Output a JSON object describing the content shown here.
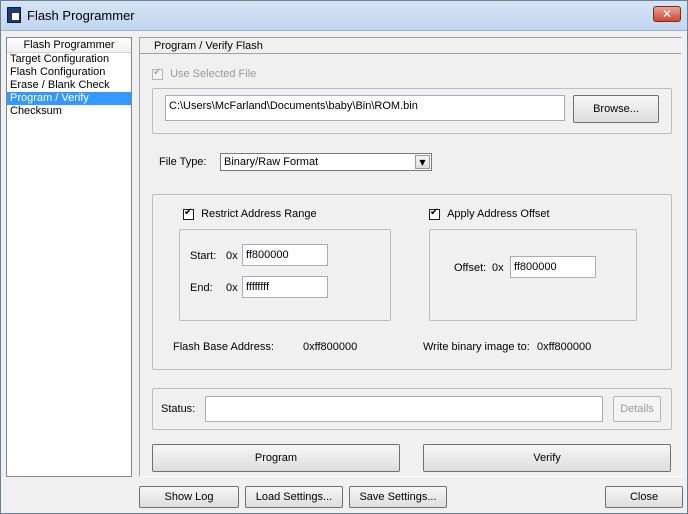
{
  "window": {
    "title": "Flash Programmer",
    "close_glyph": "✕"
  },
  "nav": {
    "header": "Flash Programmer",
    "items": [
      {
        "label": "Target Configuration"
      },
      {
        "label": "Flash Configuration"
      },
      {
        "label": "Erase / Blank Check"
      },
      {
        "label": "Program / Verify",
        "selected": true
      },
      {
        "label": "Checksum"
      }
    ]
  },
  "panel": {
    "title": "Program / Verify Flash",
    "use_selected_file": {
      "label": "Use Selected File",
      "checked": true,
      "enabled": false
    },
    "file_path": "C:\\Users\\McFarland\\Documents\\baby\\Bin\\ROM.bin",
    "browse_label": "Browse...",
    "file_type": {
      "label": "File Type:",
      "value": "Binary/Raw Format",
      "arrow": "▼"
    },
    "restrict_range": {
      "label": "Restrict Address Range",
      "checked": true
    },
    "start": {
      "label": "Start:",
      "prefix": "0x",
      "value": "ff800000"
    },
    "end": {
      "label": "End:",
      "prefix": "0x",
      "value": "ffffffff"
    },
    "apply_offset": {
      "label": "Apply Address Offset",
      "checked": true
    },
    "offset": {
      "label": "Offset:",
      "prefix": "0x",
      "value": "ff800000"
    },
    "flash_base": {
      "label": "Flash Base Address:",
      "value": "0xff800000"
    },
    "write_image": {
      "label": "Write binary image to:",
      "value": "0xff800000"
    },
    "status": {
      "label": "Status:",
      "value": ""
    },
    "details_label": "Details",
    "program_label": "Program",
    "verify_label": "Verify"
  },
  "footer": {
    "show_log": "Show Log",
    "load_settings": "Load Settings...",
    "save_settings": "Save Settings...",
    "close": "Close"
  }
}
